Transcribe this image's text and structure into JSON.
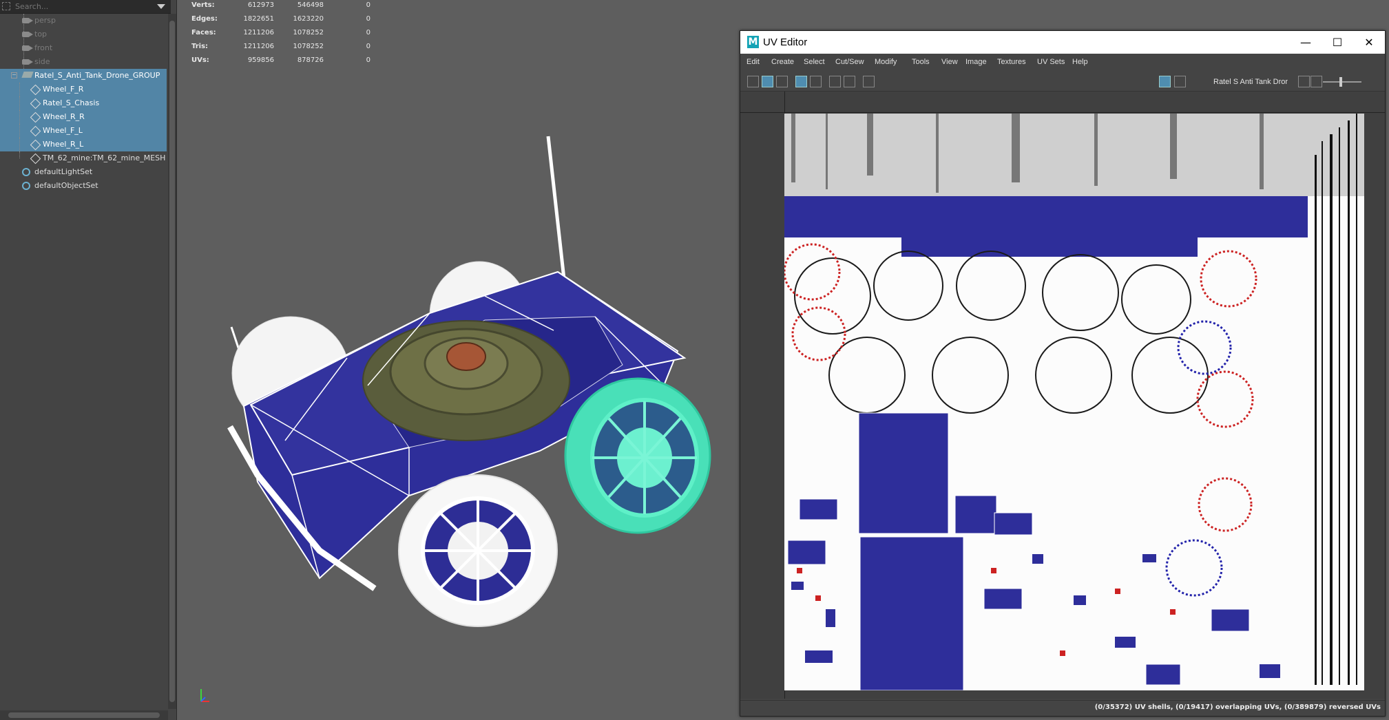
{
  "outliner": {
    "search_placeholder": "Search...",
    "items": [
      {
        "label": "persp"
      },
      {
        "label": "top"
      },
      {
        "label": "front"
      },
      {
        "label": "side"
      },
      {
        "label": "Ratel_S_Anti_Tank_Drone_GROUP"
      },
      {
        "label": "Wheel_F_R"
      },
      {
        "label": "Ratel_S_Chasis"
      },
      {
        "label": "Wheel_R_R"
      },
      {
        "label": "Wheel_F_L"
      },
      {
        "label": "Wheel_R_L"
      },
      {
        "label": "TM_62_mine:TM_62_mine_MESH"
      },
      {
        "label": "defaultLightSet"
      },
      {
        "label": "defaultObjectSet"
      }
    ]
  },
  "hud": {
    "rows": [
      {
        "label": "Verts:",
        "v1": "612973",
        "v2": "546498",
        "v3": "0"
      },
      {
        "label": "Edges:",
        "v1": "1822651",
        "v2": "1623220",
        "v3": "0"
      },
      {
        "label": "Faces:",
        "v1": "1211206",
        "v2": "1078252",
        "v3": "0"
      },
      {
        "label": "Tris:",
        "v1": "1211206",
        "v2": "1078252",
        "v3": "0"
      },
      {
        "label": "UVs:",
        "v1": "959856",
        "v2": "878726",
        "v3": "0"
      }
    ]
  },
  "uv_editor": {
    "app_icon": "M",
    "title": "UV Editor",
    "menu": [
      "Edit",
      "Create",
      "Select",
      "Cut/Sew",
      "Modify",
      "Tools",
      "View",
      "Image",
      "Textures",
      "UV Sets",
      "Help"
    ],
    "uv_set_name": "Ratel S Anti Tank Dror",
    "status": "(0/35372) UV shells, (0/19417) overlapping UVs, (0/389879) reversed UVs"
  },
  "colors": {
    "selection": "#5285a6",
    "uv_blue": "#2e2e9a",
    "wheel_highlight": "#3fe3b8"
  }
}
